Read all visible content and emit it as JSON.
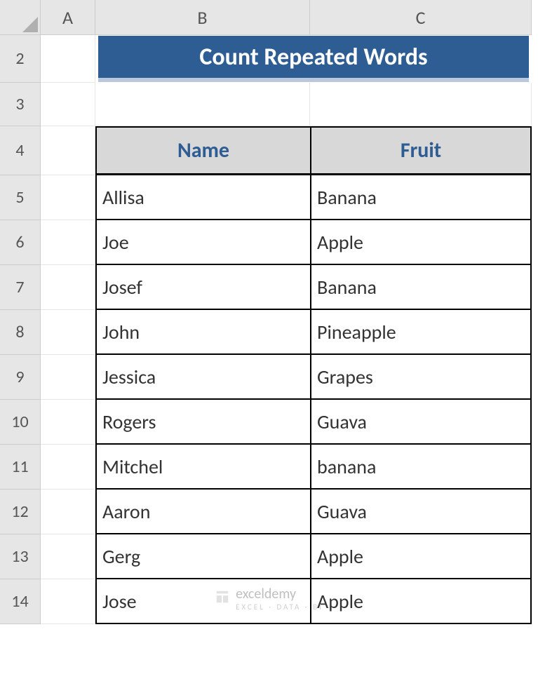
{
  "columns": [
    "A",
    "B",
    "C"
  ],
  "rows": [
    "2",
    "3",
    "4",
    "5",
    "6",
    "7",
    "8",
    "9",
    "10",
    "11",
    "12",
    "13",
    "14"
  ],
  "title": "Count Repeated Words",
  "headers": {
    "name": "Name",
    "fruit": "Fruit"
  },
  "table": [
    {
      "name": "Allisa",
      "fruit": "Banana"
    },
    {
      "name": "Joe",
      "fruit": "Apple"
    },
    {
      "name": "Josef",
      "fruit": "Banana"
    },
    {
      "name": "John",
      "fruit": "Pineapple"
    },
    {
      "name": "Jessica",
      "fruit": "Grapes"
    },
    {
      "name": "Rogers",
      "fruit": "Guava"
    },
    {
      "name": "Mitchel",
      "fruit": "banana"
    },
    {
      "name": "Aaron",
      "fruit": "Guava"
    },
    {
      "name": "Gerg",
      "fruit": "Apple"
    },
    {
      "name": "Jose",
      "fruit": "Apple"
    }
  ],
  "watermark": {
    "brand": "exceldemy",
    "sub": "EXCEL · DATA · BI"
  },
  "chart_data": {
    "type": "table",
    "title": "Count Repeated Words",
    "columns": [
      "Name",
      "Fruit"
    ],
    "rows": [
      [
        "Allisa",
        "Banana"
      ],
      [
        "Joe",
        "Apple"
      ],
      [
        "Josef",
        "Banana"
      ],
      [
        "John",
        "Pineapple"
      ],
      [
        "Jessica",
        "Grapes"
      ],
      [
        "Rogers",
        "Guava"
      ],
      [
        "Mitchel",
        "banana"
      ],
      [
        "Aaron",
        "Guava"
      ],
      [
        "Gerg",
        "Apple"
      ],
      [
        "Jose",
        "Apple"
      ]
    ]
  }
}
